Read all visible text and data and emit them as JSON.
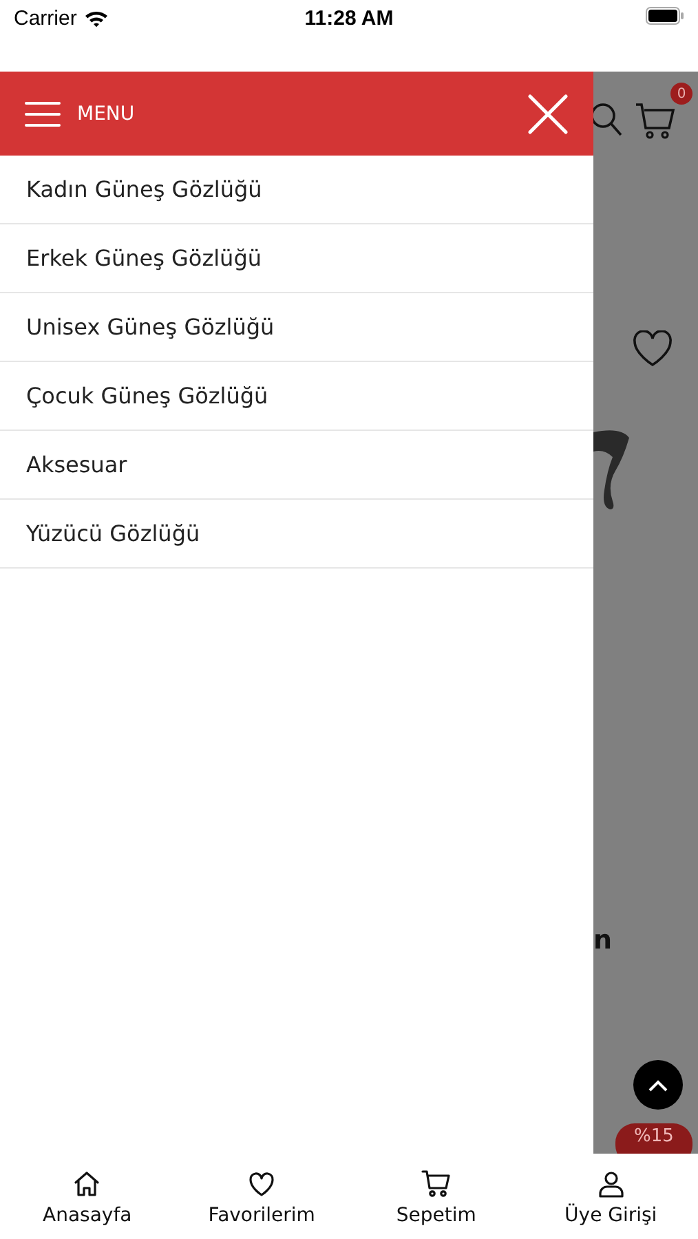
{
  "status_bar": {
    "carrier": "Carrier",
    "time": "11:28 AM"
  },
  "menu": {
    "title": "MENU",
    "items": [
      "Kadın Güneş Gözlüğü",
      "Erkek Güneş Gözlüğü",
      "Unisex Güneş Gözlüğü",
      "Çocuk Güneş Gözlüğü",
      "Aksesuar",
      "Yüzücü Gözlüğü"
    ]
  },
  "background_page": {
    "cart_count": "0",
    "text_fragment": "n",
    "discount_badge": "%15"
  },
  "tab_bar": [
    {
      "kind": "home",
      "label": "Anasayfa"
    },
    {
      "kind": "heart",
      "label": "Favorilerim"
    },
    {
      "kind": "cart",
      "label": "Sepetim"
    },
    {
      "kind": "user",
      "label": "Üye Girişi"
    }
  ]
}
